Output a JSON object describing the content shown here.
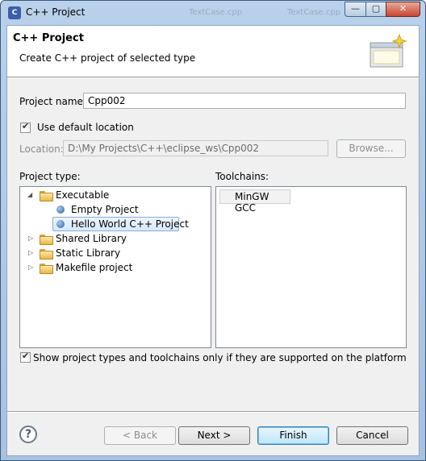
{
  "window": {
    "title": "C++ Project",
    "controls": {
      "minimize": "—",
      "maximize": "▢",
      "close": "✕"
    },
    "background_tabs": [
      "TextCase.cpp",
      "TextCase.cpp"
    ]
  },
  "header": {
    "title": "C++ Project",
    "description": "Create C++ project of selected type"
  },
  "project_name": {
    "label": "Project name:",
    "value": "Cpp002"
  },
  "default_location": {
    "label": "Use default location",
    "checked": true
  },
  "location": {
    "label": "Location:",
    "value": "D:\\My Projects\\C++\\eclipse_ws\\Cpp002",
    "browse_label": "Browse..."
  },
  "project_type": {
    "label": "Project type:",
    "items": [
      {
        "label": "Executable",
        "kind": "folder",
        "expanded": true,
        "level": 0
      },
      {
        "label": "Empty Project",
        "kind": "template",
        "level": 1
      },
      {
        "label": "Hello World C++ Project",
        "kind": "template",
        "level": 1,
        "selected": true
      },
      {
        "label": "Shared Library",
        "kind": "folder",
        "expanded": false,
        "level": 0
      },
      {
        "label": "Static Library",
        "kind": "folder",
        "expanded": false,
        "level": 0
      },
      {
        "label": "Makefile project",
        "kind": "folder",
        "expanded": false,
        "level": 0
      }
    ]
  },
  "toolchains": {
    "label": "Toolchains:",
    "items": [
      {
        "label": "MinGW GCC"
      }
    ]
  },
  "show_supported": {
    "label": "Show project types and toolchains only if they are supported on the platform",
    "checked": true
  },
  "buttons": {
    "help": "?",
    "back": "< Back",
    "next": "Next >",
    "finish": "Finish",
    "cancel": "Cancel"
  }
}
